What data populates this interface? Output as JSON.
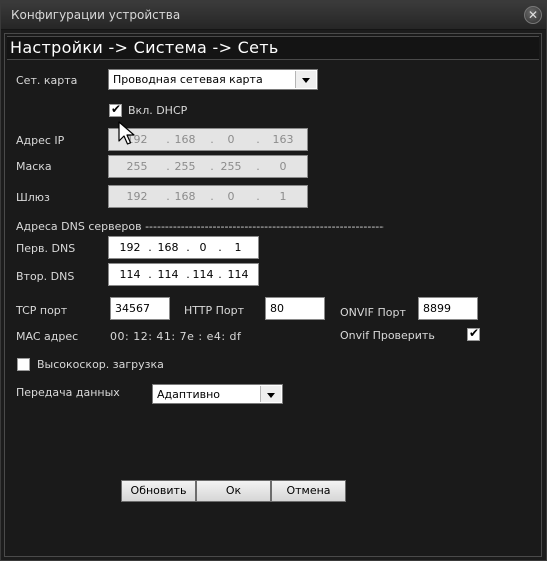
{
  "window": {
    "title": "Конфигурации устройства"
  },
  "header": {
    "title": "Настройки -> Система -> Сеть"
  },
  "form": {
    "net_card": {
      "label": "Сет. карта",
      "value": "Проводная сетевая карта"
    },
    "dhcp": {
      "label": "Вкл. DHCP",
      "checked": true
    },
    "ip": {
      "label": "Адрес IP",
      "octets": [
        "192",
        "168",
        "0",
        "163"
      ]
    },
    "mask": {
      "label": "Маска",
      "octets": [
        "255",
        "255",
        "255",
        "0"
      ]
    },
    "gateway": {
      "label": "Шлюз",
      "octets": [
        "192",
        "168",
        "0",
        "1"
      ]
    },
    "dns_section": {
      "label": "Адреса DNS серверов -----------------------------------------------------------------"
    },
    "dns1": {
      "label": "Перв. DNS",
      "octets": [
        "192",
        "168",
        "0",
        "1"
      ]
    },
    "dns2": {
      "label": "Втор. DNS",
      "octets": [
        "114",
        "114",
        "114",
        "114"
      ]
    },
    "tcp_port": {
      "label": "TCP порт",
      "value": "34567"
    },
    "http_port": {
      "label": "HTTP Порт",
      "value": "80"
    },
    "onvif_port": {
      "label": "ONVIF Порт",
      "value": "8899"
    },
    "mac": {
      "label": "MAC адрес",
      "value": "00: 12: 41: 7e : e4: df"
    },
    "onvif_check": {
      "label": "Onvif Проверить",
      "checked": true
    },
    "high_speed": {
      "label": "Высокоскор. загрузка",
      "checked": false
    },
    "transfer": {
      "label": "Передача данных",
      "value": "Адаптивно"
    }
  },
  "buttons": {
    "refresh": "Обновить",
    "ok": "Ок",
    "cancel": "Отмена"
  },
  "icons": {
    "close": "close-icon",
    "cursor": "mouse-pointer-icon"
  }
}
